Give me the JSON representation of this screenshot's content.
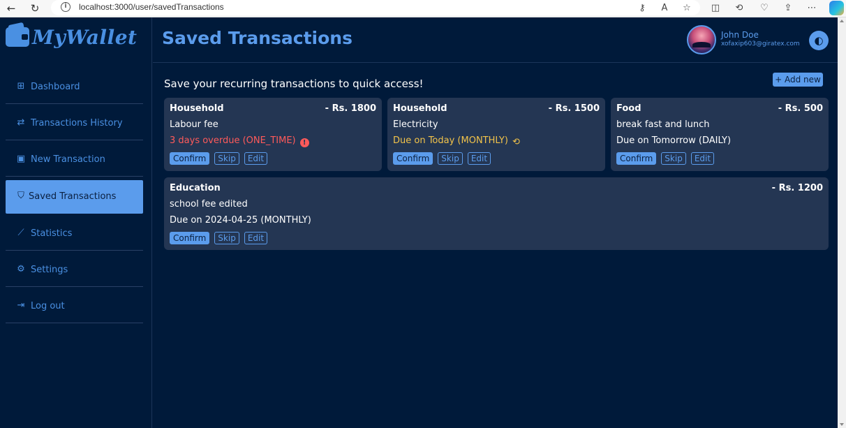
{
  "browser": {
    "url": "localhost:3000/user/savedTransactions"
  },
  "app": {
    "logo_text": "MyWallet"
  },
  "sidebar": {
    "items": [
      {
        "label": "Dashboard",
        "icon": "grid-icon"
      },
      {
        "label": "Transactions History",
        "icon": "arrows-exchange-icon"
      },
      {
        "label": "New Transaction",
        "icon": "calendar-plus-icon"
      },
      {
        "label": "Saved Transactions",
        "icon": "bookmark-icon",
        "active": true
      },
      {
        "label": "Statistics",
        "icon": "line-chart-icon"
      },
      {
        "label": "Settings",
        "icon": "gear-icon"
      },
      {
        "label": "Log out",
        "icon": "logout-icon"
      }
    ]
  },
  "header": {
    "title": "Saved Transactions",
    "user_name": "John Doe",
    "user_email": "xofaxip603@giratex.com"
  },
  "main": {
    "subtitle": "Save your recurring transactions to quick access!",
    "add_label": "+ Add new",
    "buttons": {
      "confirm": "Confirm",
      "skip": "Skip",
      "edit": "Edit"
    },
    "cards": [
      {
        "category": "Household",
        "amount": "- Rs. 1800",
        "description": "Labour fee",
        "due": "3 days overdue (ONE_TIME)",
        "status": "overdue"
      },
      {
        "category": "Household",
        "amount": "- Rs. 1500",
        "description": "Electricity",
        "due": "Due on Today (MONTHLY)",
        "status": "today"
      },
      {
        "category": "Food",
        "amount": "- Rs. 500",
        "description": "break fast and lunch",
        "due": "Due on Tomorrow (DAILY)",
        "status": "upcoming"
      },
      {
        "category": "Education",
        "amount": "- Rs. 1200",
        "description": "school fee edited",
        "due": "Due on 2024-04-25 (MONTHLY)",
        "status": "upcoming"
      }
    ]
  },
  "colors": {
    "background": "#001a3a",
    "accent": "#5b9cec",
    "card": "#243653",
    "overdue": "#ff5a5a",
    "due_today": "#f2c34a"
  }
}
